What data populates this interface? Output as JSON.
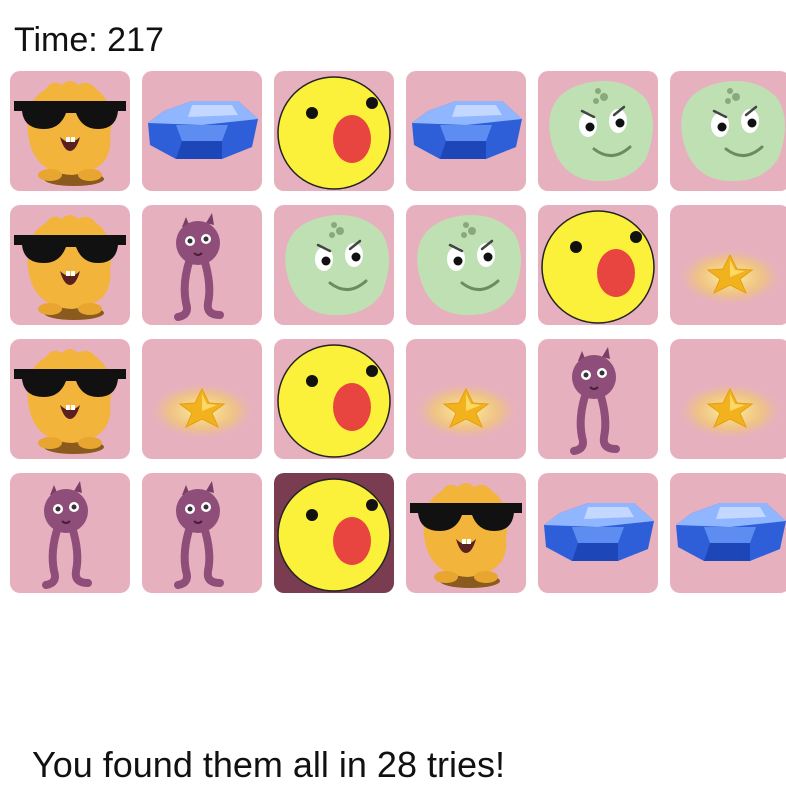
{
  "timer": {
    "text": "Time: 217"
  },
  "message": {
    "text": "You found them all in 28 tries!"
  },
  "colors": {
    "tile_bg": "#e6b0bf",
    "tile_highlight_bg": "#7a3c51"
  },
  "board": {
    "rows": [
      [
        "monster-sunglasses-icon",
        "blue-gem-icon",
        "yellow-surprised-face-icon",
        "blue-gem-icon",
        "green-blob-icon",
        "green-blob-icon"
      ],
      [
        "monster-sunglasses-icon",
        "purple-squid-icon",
        "green-blob-icon",
        "green-blob-icon",
        "yellow-surprised-face-icon",
        "gold-star-icon"
      ],
      [
        "monster-sunglasses-icon",
        "gold-star-icon",
        "yellow-surprised-face-icon",
        "gold-star-icon",
        "purple-squid-icon",
        "gold-star-icon"
      ],
      [
        "purple-squid-icon",
        "purple-squid-icon",
        "yellow-surprised-face-icon",
        "monster-sunglasses-icon",
        "blue-gem-icon",
        "blue-gem-icon"
      ]
    ],
    "highlighted": [
      [
        3,
        2
      ]
    ]
  }
}
